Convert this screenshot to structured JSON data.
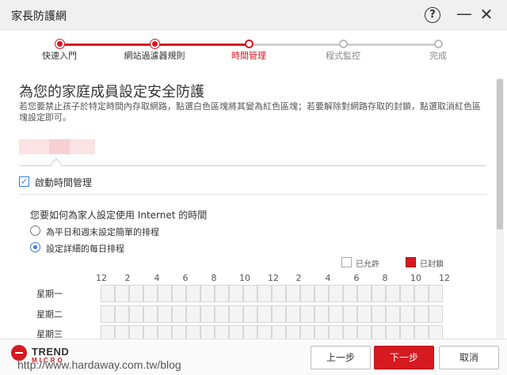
{
  "window": {
    "title": "家長防護網",
    "help_icon": "?",
    "minimize_icon": "—",
    "close_icon": "✕"
  },
  "stepper": {
    "steps": [
      {
        "label": "快速入門",
        "state": "done"
      },
      {
        "label": "網站過濾器規則",
        "state": "done"
      },
      {
        "label": "時間管理",
        "state": "current"
      },
      {
        "label": "程式監控",
        "state": "todo"
      },
      {
        "label": "完成",
        "state": "todo"
      }
    ]
  },
  "main": {
    "heading": "為您的家庭成員設定安全防護",
    "description": "若您要禁止孩子於特定時間內存取網路，點選白色區塊將其變為紅色區塊；若要解除對網路存取的封鎖，點選取消紅色區塊設定即可。",
    "enable_checkbox": {
      "label": "啟動時間管理",
      "checked": true
    },
    "question": "您要如何為家人設定使用 Internet 的時間",
    "radios": [
      {
        "label": "為平日和週末設定簡單的排程",
        "selected": false
      },
      {
        "label": "設定詳細的每日排程",
        "selected": true
      }
    ],
    "legend": {
      "allowed": "已允許",
      "blocked": "已封鎖"
    },
    "hours": [
      "12",
      "2",
      "4",
      "6",
      "8",
      "10",
      "12",
      "2",
      "4",
      "6",
      "8",
      "10",
      "12"
    ],
    "days": [
      "星期一",
      "星期二",
      "星期三"
    ],
    "colors": {
      "accent": "#d71920",
      "blocked": "#d71920",
      "allowed": "#f4f4f4"
    }
  },
  "footer": {
    "brand": "TREND",
    "brand_sub": "MICRO",
    "watermark": "http://www.hardaway.com.tw/blog",
    "prev_label": "上一步",
    "next_label": "下一步",
    "cancel_label": "取消"
  }
}
